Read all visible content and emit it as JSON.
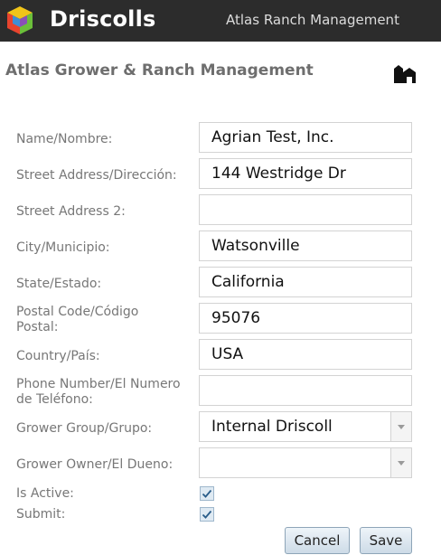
{
  "header": {
    "brand": "Driscolls",
    "app_name": "Atlas Ranch Management",
    "logo_icon": "driscolls-cube-logo"
  },
  "page": {
    "title": "Atlas Grower & Ranch Management",
    "title_icon": "ranch-house-icon"
  },
  "form": {
    "name_label": "Name/Nombre:",
    "name_value": "Agrian Test, Inc.",
    "street_label": "Street Address/Dirección:",
    "street_value": "144 Westridge Dr",
    "street2_label": "Street Address 2:",
    "street2_value": "",
    "city_label": "City/Municipio:",
    "city_value": "Watsonville",
    "state_label": "State/Estado:",
    "state_value": "California",
    "postal_label": "Postal Code/Código Postal:",
    "postal_value": "95076",
    "country_label": "Country/País:",
    "country_value": "USA",
    "phone_label": "Phone Number/El Numero de Teléfono:",
    "phone_value": "",
    "group_label": "Grower Group/Grupo:",
    "group_value": "Internal Driscoll",
    "owner_label": "Grower Owner/El Dueno:",
    "owner_value": "",
    "active_label": "Is Active:",
    "active_checked": true,
    "submit_label": "Submit:",
    "submit_checked": true
  },
  "buttons": {
    "cancel": "Cancel",
    "save": "Save"
  },
  "colors": {
    "header_bg": "#2c2c2c",
    "label_text": "#777777",
    "button_border": "#8ea5b8"
  }
}
